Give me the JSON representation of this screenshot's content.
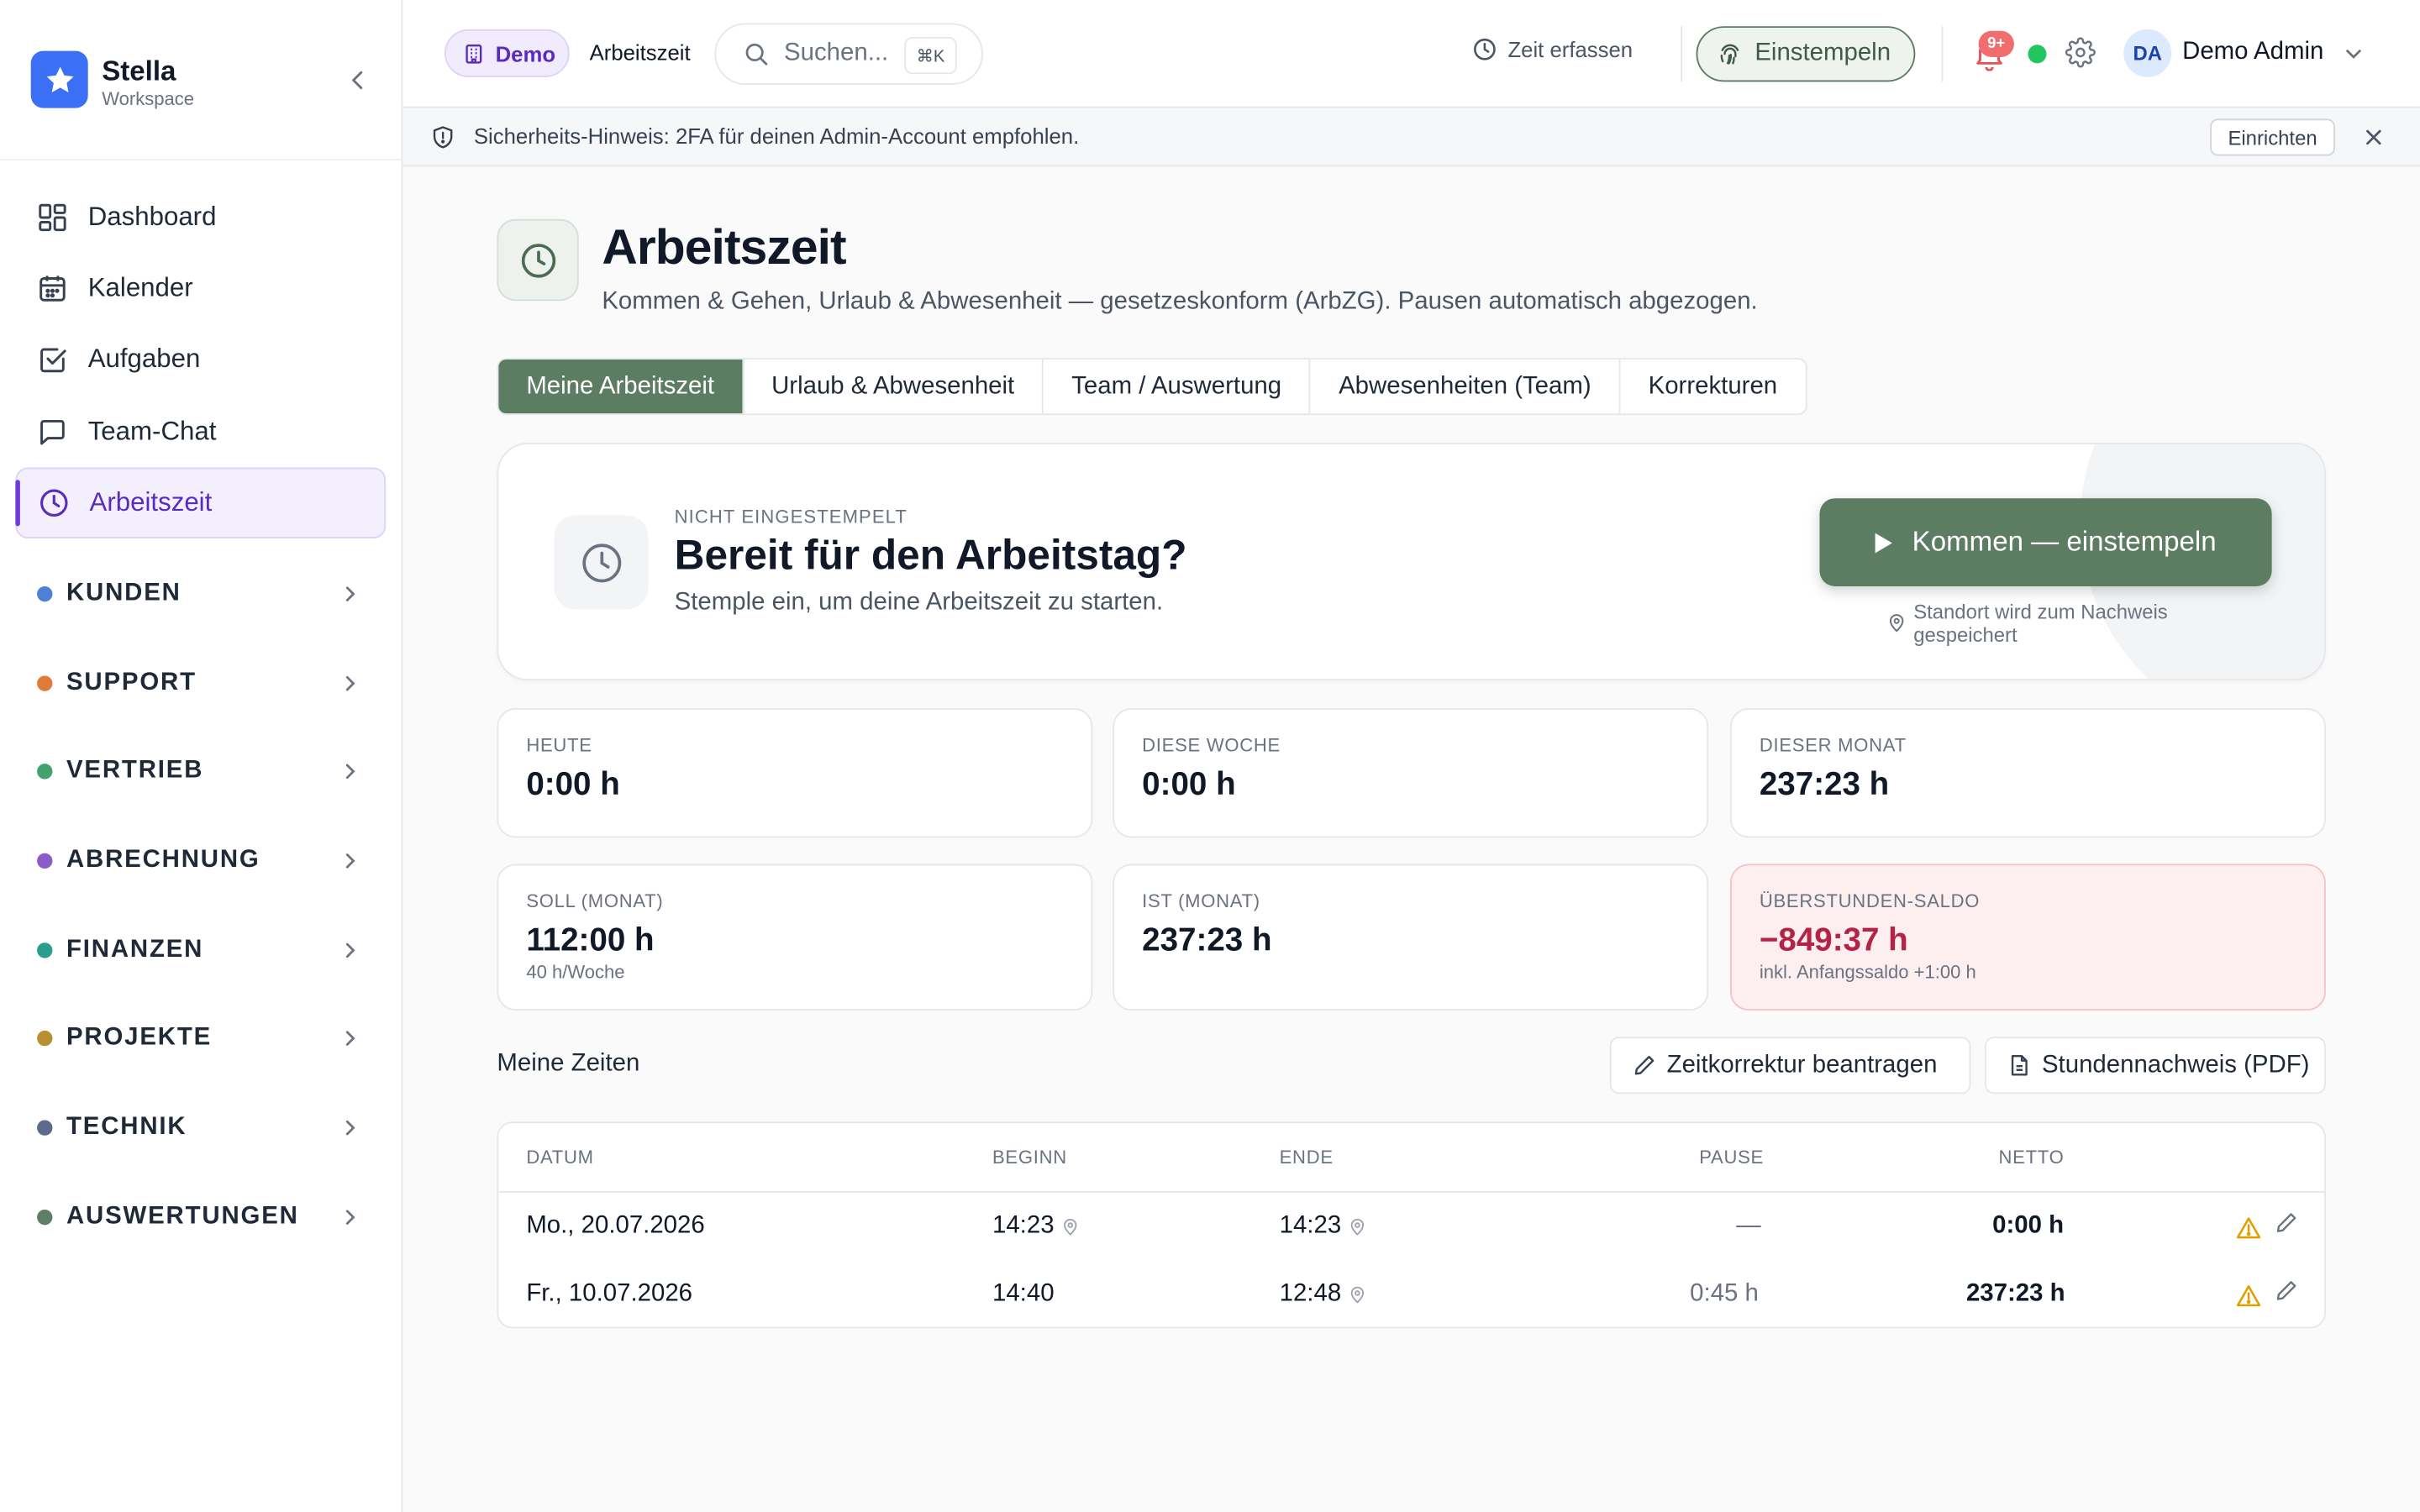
{
  "brand": {
    "name": "Stella",
    "subtitle": "Workspace"
  },
  "sidebar": {
    "items": [
      {
        "label": "Dashboard"
      },
      {
        "label": "Kalender"
      },
      {
        "label": "Aufgaben"
      },
      {
        "label": "Team-Chat"
      },
      {
        "label": "Arbeitszeit",
        "active": true
      }
    ],
    "groups": [
      {
        "label": "KUNDEN",
        "color": "#4f80d6"
      },
      {
        "label": "SUPPORT",
        "color": "#e07b39"
      },
      {
        "label": "VERTRIEB",
        "color": "#3fa36b"
      },
      {
        "label": "ABRECHNUNG",
        "color": "#8b5cc7"
      },
      {
        "label": "FINANZEN",
        "color": "#2a9d8f"
      },
      {
        "label": "PROJEKTE",
        "color": "#b8902f"
      },
      {
        "label": "TECHNIK",
        "color": "#5b6b8a"
      },
      {
        "label": "AUSWERTUNGEN",
        "color": "#5e7f66"
      }
    ]
  },
  "topbar": {
    "demo_label": "Demo",
    "breadcrumb": "Arbeitszeit",
    "search_placeholder": "Suchen...",
    "search_shortcut": "⌘K",
    "time_entry_label": "Zeit erfassen",
    "clock_in_label": "Einstempeln",
    "notification_count": "9+",
    "user_initials": "DA",
    "user_name": "Demo Admin"
  },
  "banner": {
    "text": "Sicherheits-Hinweis: 2FA für deinen Admin-Account empfohlen.",
    "action_label": "Einrichten"
  },
  "header": {
    "title": "Arbeitszeit",
    "subtitle": "Kommen & Gehen, Urlaub & Abwesenheit — gesetzeskonform (ArbZG). Pausen automatisch abgezogen."
  },
  "tabs": [
    {
      "label": "Meine Arbeitszeit",
      "active": true
    },
    {
      "label": "Urlaub & Abwesenheit"
    },
    {
      "label": "Team / Auswertung"
    },
    {
      "label": "Abwesenheiten (Team)"
    },
    {
      "label": "Korrekturen"
    }
  ],
  "hero": {
    "eyebrow": "NICHT EINGESTEMPELT",
    "title": "Bereit für den Arbeitstag?",
    "subtitle": "Stemple ein, um deine Arbeitszeit zu starten.",
    "button_label": "Kommen — einstempeln",
    "location_note": "Standort wird zum Nachweis gespeichert"
  },
  "stats": [
    {
      "label": "HEUTE",
      "value": "0:00 h"
    },
    {
      "label": "DIESE WOCHE",
      "value": "0:00 h"
    },
    {
      "label": "DIESER MONAT",
      "value": "237:23 h"
    },
    {
      "label": "SOLL (MONAT)",
      "value": "112:00 h",
      "note": "40 h/Woche"
    },
    {
      "label": "IST (MONAT)",
      "value": "237:23 h"
    },
    {
      "label": "ÜBERSTUNDEN-SALDO",
      "value": "−849:37 h",
      "note": "inkl. Anfangssaldo +1:00 h",
      "negative": true
    }
  ],
  "times": {
    "title": "Meine Zeiten",
    "correction_label": "Zeitkorrektur beantragen",
    "pdf_label": "Stundennachweis (PDF)",
    "columns": [
      "DATUM",
      "BEGINN",
      "ENDE",
      "PAUSE",
      "NETTO"
    ],
    "rows": [
      {
        "date": "Mo., 20.07.2026",
        "begin": "14:23",
        "end": "14:23",
        "pause": "—",
        "net": "0:00 h"
      },
      {
        "date": "Fr., 10.07.2026",
        "begin": "14:40",
        "end": "12:48",
        "pause": "0:45 h",
        "net": "237:23 h"
      }
    ]
  },
  "colors": {
    "accent_green": "#5d7d63",
    "active_purple": "#5b2bbd",
    "negative_red": "#b42345",
    "warning_amber": "#e0a100"
  }
}
